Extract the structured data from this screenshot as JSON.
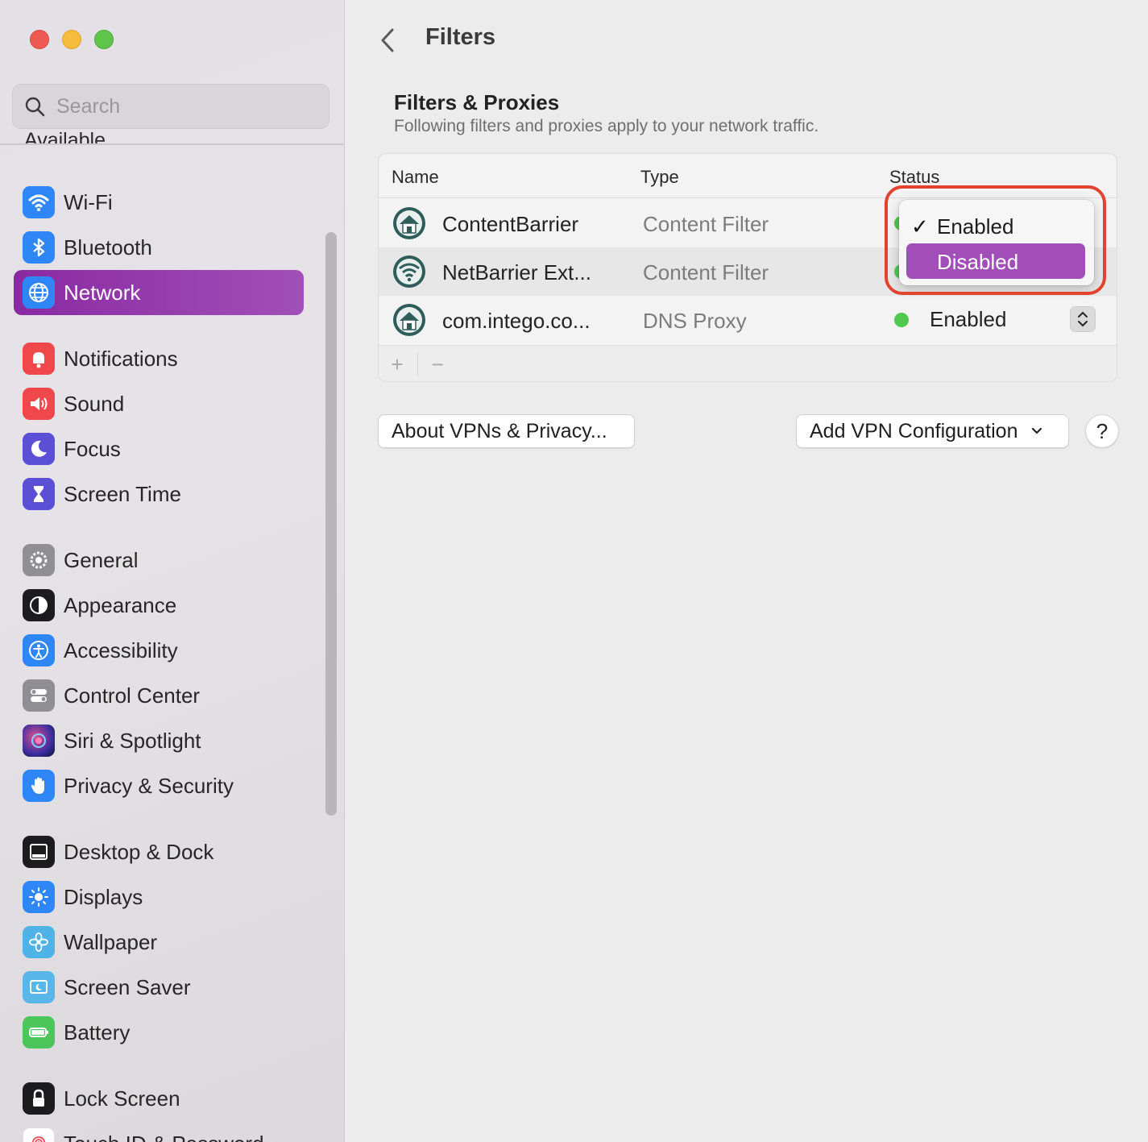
{
  "sidebar": {
    "search_placeholder": "Search",
    "cut_off_label": "Available",
    "items": [
      {
        "label": "Wi-Fi",
        "icon": "wifi-icon",
        "color": "#2f86f6"
      },
      {
        "label": "Bluetooth",
        "icon": "bluetooth-icon",
        "color": "#2f86f6"
      },
      {
        "label": "Network",
        "icon": "globe-icon",
        "color": "#2f86f6"
      },
      {
        "label": "Notifications",
        "icon": "bell-icon",
        "color": "#f0474a"
      },
      {
        "label": "Sound",
        "icon": "speaker-icon",
        "color": "#f0474a"
      },
      {
        "label": "Focus",
        "icon": "moon-icon",
        "color": "#5b4fd6"
      },
      {
        "label": "Screen Time",
        "icon": "hourglass-icon",
        "color": "#5b4fd6"
      },
      {
        "label": "General",
        "icon": "gear-icon",
        "color": "#8e8e93"
      },
      {
        "label": "Appearance",
        "icon": "appearance-icon",
        "color": "#1c1c1e"
      },
      {
        "label": "Accessibility",
        "icon": "accessibility-icon",
        "color": "#2f86f6"
      },
      {
        "label": "Control Center",
        "icon": "toggles-icon",
        "color": "#8e8e93"
      },
      {
        "label": "Siri & Spotlight",
        "icon": "siri-icon",
        "color": "#3a2a6a"
      },
      {
        "label": "Privacy & Security",
        "icon": "hand-icon",
        "color": "#2f86f6"
      },
      {
        "label": "Desktop & Dock",
        "icon": "dock-icon",
        "color": "#1c1c1e"
      },
      {
        "label": "Displays",
        "icon": "sun-icon",
        "color": "#2f86f6"
      },
      {
        "label": "Wallpaper",
        "icon": "flower-icon",
        "color": "#4fb3e8"
      },
      {
        "label": "Screen Saver",
        "icon": "screensaver-icon",
        "color": "#58b6e8"
      },
      {
        "label": "Battery",
        "icon": "battery-icon",
        "color": "#4cc65a"
      },
      {
        "label": "Lock Screen",
        "icon": "lock-icon",
        "color": "#1c1c1e"
      },
      {
        "label": "Touch ID & Password",
        "icon": "fingerprint-icon",
        "color": "#f04a58"
      }
    ],
    "active_item": "Network",
    "accent": "#9a3fb2"
  },
  "main": {
    "title": "Filters",
    "section_title": "Filters & Proxies",
    "section_subtitle": "Following filters and proxies apply to your network traffic.",
    "table": {
      "columns": [
        "Name",
        "Type",
        "Status"
      ],
      "rows": [
        {
          "name": "ContentBarrier",
          "type": "Content Filter",
          "status": "Enabled"
        },
        {
          "name": "NetBarrier Ext...",
          "type": "Content Filter",
          "status": "Enabled"
        },
        {
          "name": "com.intego.co...",
          "type": "DNS Proxy",
          "status": "Enabled"
        }
      ]
    },
    "status_menu": {
      "options": [
        "Enabled",
        "Disabled"
      ],
      "checked": "Enabled",
      "highlighted": "Disabled"
    },
    "about_button": "About VPNs & Privacy...",
    "add_vpn_button": "Add VPN Configuration",
    "help_button": "?",
    "add_symbol": "+",
    "remove_symbol": "−",
    "status_color": "#4fc84e",
    "highlight_ring_color": "#e2432e"
  }
}
